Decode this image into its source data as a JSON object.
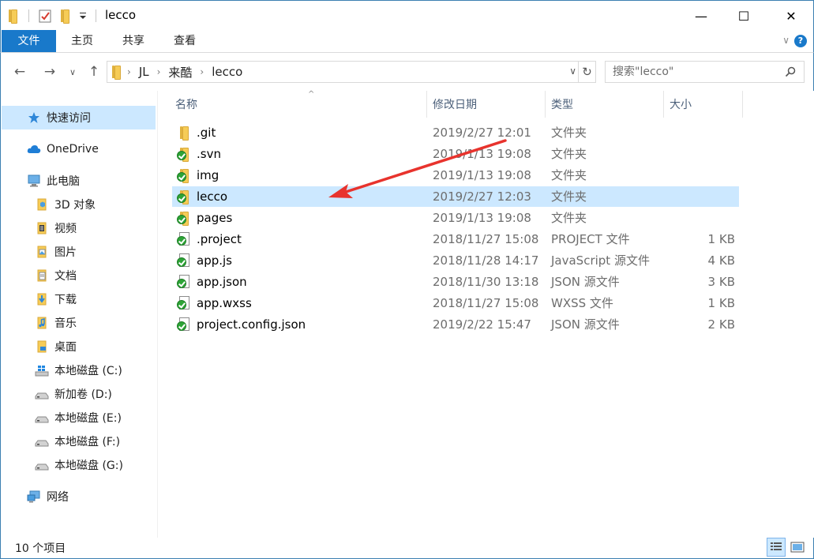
{
  "window": {
    "title": "lecco",
    "minimize_glyph": "—",
    "maximize_glyph": "☐",
    "close_glyph": "✕"
  },
  "quick_access_toolbar": {
    "icons": [
      "folder-icon",
      "properties-checkmark-icon",
      "new-folder-icon",
      "customize-dropdown-icon"
    ]
  },
  "ribbon": {
    "tabs": [
      {
        "label": "文件",
        "active": true
      },
      {
        "label": "主页"
      },
      {
        "label": "共享"
      },
      {
        "label": "查看"
      }
    ],
    "collapse_glyph": "∨",
    "help_glyph": "?",
    "accent_color": "#1979ca"
  },
  "address_bar": {
    "back_glyph": "←",
    "forward_glyph": "→",
    "recent_glyph": "∨",
    "up_glyph": "↑",
    "breadcrumb": [
      "JL",
      "来酷",
      "lecco"
    ],
    "crumb_separator": "›",
    "dropdown_glyph": "∨",
    "refresh_glyph": "↻"
  },
  "search": {
    "placeholder": "搜索\"lecco\""
  },
  "nav_pane": {
    "items": [
      {
        "label": "快速访问",
        "icon": "star-icon",
        "selected": true
      },
      {
        "label": "OneDrive",
        "icon": "cloud-icon"
      },
      {
        "label": "此电脑",
        "icon": "computer-icon"
      },
      {
        "label": "3D 对象",
        "icon": "3d-objects-icon"
      },
      {
        "label": "视频",
        "icon": "video-icon"
      },
      {
        "label": "图片",
        "icon": "pictures-icon"
      },
      {
        "label": "文档",
        "icon": "documents-icon"
      },
      {
        "label": "下载",
        "icon": "downloads-icon"
      },
      {
        "label": "音乐",
        "icon": "music-icon"
      },
      {
        "label": "桌面",
        "icon": "desktop-icon"
      },
      {
        "label": "本地磁盘 (C:)",
        "icon": "windows-drive-icon"
      },
      {
        "label": "新加卷 (D:)",
        "icon": "drive-icon"
      },
      {
        "label": "本地磁盘 (E:)",
        "icon": "drive-icon"
      },
      {
        "label": "本地磁盘 (F:)",
        "icon": "drive-icon"
      },
      {
        "label": "本地磁盘 (G:)",
        "icon": "drive-icon"
      },
      {
        "label": "网络",
        "icon": "network-icon"
      }
    ]
  },
  "file_list": {
    "sort_glyph": "^",
    "columns": {
      "name": "名称",
      "date": "修改日期",
      "type": "类型",
      "size": "大小"
    },
    "rows": [
      {
        "name": ".git",
        "date": "2019/2/27 12:01",
        "type": "文件夹",
        "size": "",
        "icon": "folder-icon",
        "svn": false
      },
      {
        "name": ".svn",
        "date": "2019/1/13 19:08",
        "type": "文件夹",
        "size": "",
        "icon": "folder-icon",
        "svn": true
      },
      {
        "name": "img",
        "date": "2019/1/13 19:08",
        "type": "文件夹",
        "size": "",
        "icon": "folder-icon",
        "svn": true
      },
      {
        "name": "lecco",
        "date": "2019/2/27 12:03",
        "type": "文件夹",
        "size": "",
        "icon": "folder-icon",
        "svn": true,
        "selected": true
      },
      {
        "name": "pages",
        "date": "2019/1/13 19:08",
        "type": "文件夹",
        "size": "",
        "icon": "folder-icon",
        "svn": true
      },
      {
        "name": ".project",
        "date": "2018/11/27 15:08",
        "type": "PROJECT 文件",
        "size": "1 KB",
        "icon": "file-icon",
        "svn": true
      },
      {
        "name": "app.js",
        "date": "2018/11/28 14:17",
        "type": "JavaScript 源文件",
        "size": "4 KB",
        "icon": "file-icon",
        "svn": true
      },
      {
        "name": "app.json",
        "date": "2018/11/30 13:18",
        "type": "JSON 源文件",
        "size": "3 KB",
        "icon": "file-icon",
        "svn": true
      },
      {
        "name": "app.wxss",
        "date": "2018/11/27 15:08",
        "type": "WXSS 文件",
        "size": "1 KB",
        "icon": "file-icon",
        "svn": true
      },
      {
        "name": "project.config.json",
        "date": "2019/2/22 15:47",
        "type": "JSON 源文件",
        "size": "2 KB",
        "icon": "file-icon",
        "svn": true
      }
    ]
  },
  "annotation": {
    "arrow_color": "#e8332d",
    "points_to": "lecco"
  },
  "status_bar": {
    "item_count": "10 个项目",
    "views": [
      {
        "name": "details-view",
        "active": true
      },
      {
        "name": "large-icons-view",
        "active": false
      }
    ]
  }
}
